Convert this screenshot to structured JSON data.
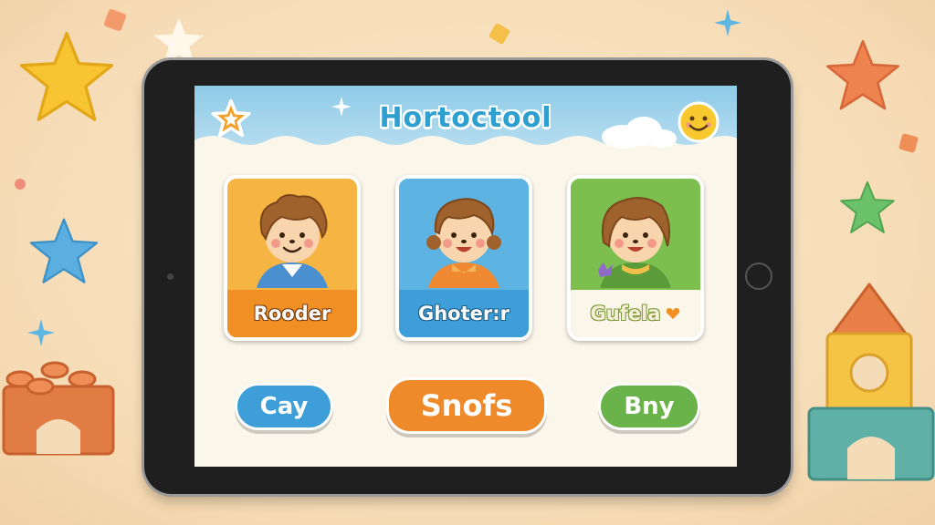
{
  "colors": {
    "background": "#f6dcb6",
    "tablet_bezel": "#1f1f1f",
    "title": "#2f9fcf",
    "card_orange": "#f2a12c",
    "card_blue": "#4aa6d8",
    "card_green": "#74b24a",
    "button_blue": "#3d9ed8",
    "button_orange": "#ee8a2a",
    "button_green": "#6ab24a"
  },
  "app": {
    "title": "Hortoctool",
    "left_icon": "star-icon",
    "right_icon": "smiley-face-icon"
  },
  "cards": [
    {
      "label": "Rooder",
      "color": "orange",
      "icon": "child-avatar"
    },
    {
      "label": "Ghoter:r",
      "color": "blue",
      "icon": "child-avatar"
    },
    {
      "label": "Gufela",
      "color": "green",
      "icon": "child-avatar"
    }
  ],
  "buttons": [
    {
      "label": "Cay",
      "color": "blue"
    },
    {
      "label": "Snofs",
      "color": "orange"
    },
    {
      "label": "Bny",
      "color": "green"
    }
  ]
}
